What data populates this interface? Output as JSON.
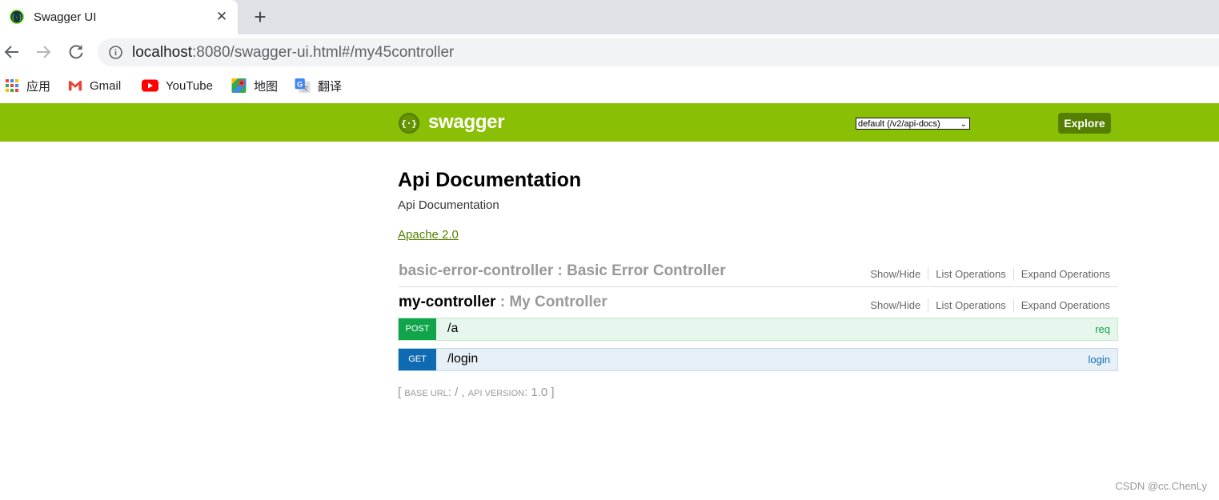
{
  "browser": {
    "tab_title": "Swagger UI",
    "tab_close": "✕",
    "new_tab": "+",
    "url_host": "localhost",
    "url_rest": ":8080/swagger-ui.html#/my45controller",
    "bookmarks": [
      {
        "label": "应用",
        "icon": "apps-grid-icon"
      },
      {
        "label": "Gmail",
        "icon": "gmail-icon"
      },
      {
        "label": "YouTube",
        "icon": "youtube-icon"
      },
      {
        "label": "地图",
        "icon": "maps-icon"
      },
      {
        "label": "翻译",
        "icon": "translate-icon"
      }
    ]
  },
  "swagger": {
    "logo_text": "swagger",
    "api_select": "default (/v2/api-docs)",
    "explore_label": "Explore",
    "info": {
      "title": "Api Documentation",
      "description": "Api Documentation",
      "license": "Apache 2.0"
    },
    "resources": [
      {
        "name": "basic-error-controller",
        "separator": " : ",
        "description": "Basic Error Controller",
        "ops": [
          "Show/Hide",
          "List Operations",
          "Expand Operations"
        ]
      },
      {
        "name": "my-controller",
        "separator": " : ",
        "description": "My Controller",
        "ops": [
          "Show/Hide",
          "List Operations",
          "Expand Operations"
        ]
      }
    ],
    "operations": [
      {
        "method": "POST",
        "path": "/a",
        "summary": "req"
      },
      {
        "method": "GET",
        "path": "/login",
        "summary": "login"
      }
    ],
    "footer": {
      "open": "[ ",
      "base_url_label": "base url",
      "base_url_value": ": / , ",
      "api_version_label": "api version",
      "api_version_value": ": 1.0 ]"
    }
  },
  "watermark": "CSDN @cc.ChenLy",
  "colors": {
    "header": "#89bf04",
    "explore": "#547f00",
    "post": "#10a54a",
    "get": "#0f6ab4"
  }
}
